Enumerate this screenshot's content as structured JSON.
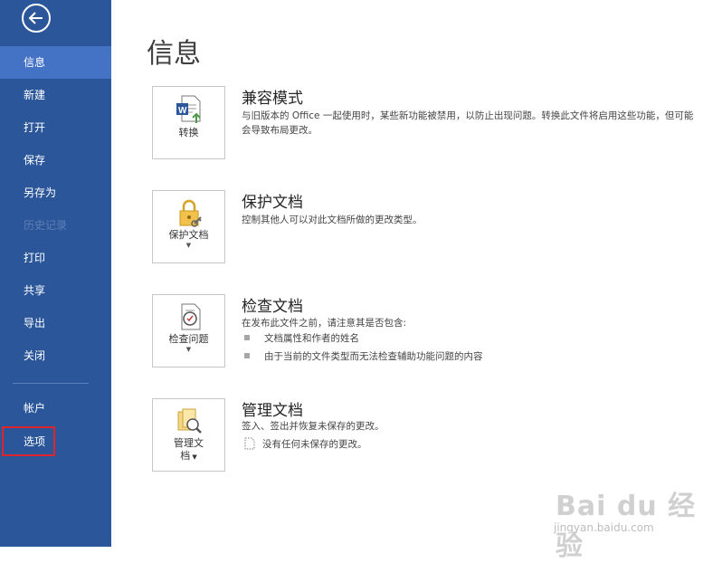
{
  "sidebar": {
    "items": [
      {
        "label": "信息",
        "active": true
      },
      {
        "label": "新建"
      },
      {
        "label": "打开"
      },
      {
        "label": "保存"
      },
      {
        "label": "另存为"
      },
      {
        "label": "历史记录",
        "disabled": true
      },
      {
        "label": "打印"
      },
      {
        "label": "共享"
      },
      {
        "label": "导出"
      },
      {
        "label": "关闭"
      }
    ],
    "account": "帐户",
    "options": "选项"
  },
  "main": {
    "title": "信息",
    "sections": [
      {
        "button": "转换",
        "title": "兼容模式",
        "desc": "与旧版本的 Office 一起使用时，某些新功能被禁用，以防止出现问题。转换此文件将启用这些功能，但可能会导致布局更改。"
      },
      {
        "button": "保护文档",
        "title": "保护文档",
        "desc": "控制其他人可以对此文档所做的更改类型。"
      },
      {
        "button": "检查问题",
        "title": "检查文档",
        "desc": "在发布此文件之前，请注意其是否包含:",
        "bullets": [
          "文档属性和作者的姓名",
          "由于当前的文件类型而无法检查辅助功能问题的内容"
        ]
      },
      {
        "button_line1": "管理文",
        "button_line2": "档",
        "title": "管理文档",
        "desc": "签入、签出并恢复未保存的更改。",
        "note": "没有任何未保存的更改。"
      }
    ]
  },
  "watermark": {
    "brand": "Bai du 经验",
    "sub": "jingyan.baidu.com"
  },
  "colors": {
    "sidebar": "#2b579a",
    "active": "#4472c4",
    "highlight": "#e0242c"
  }
}
